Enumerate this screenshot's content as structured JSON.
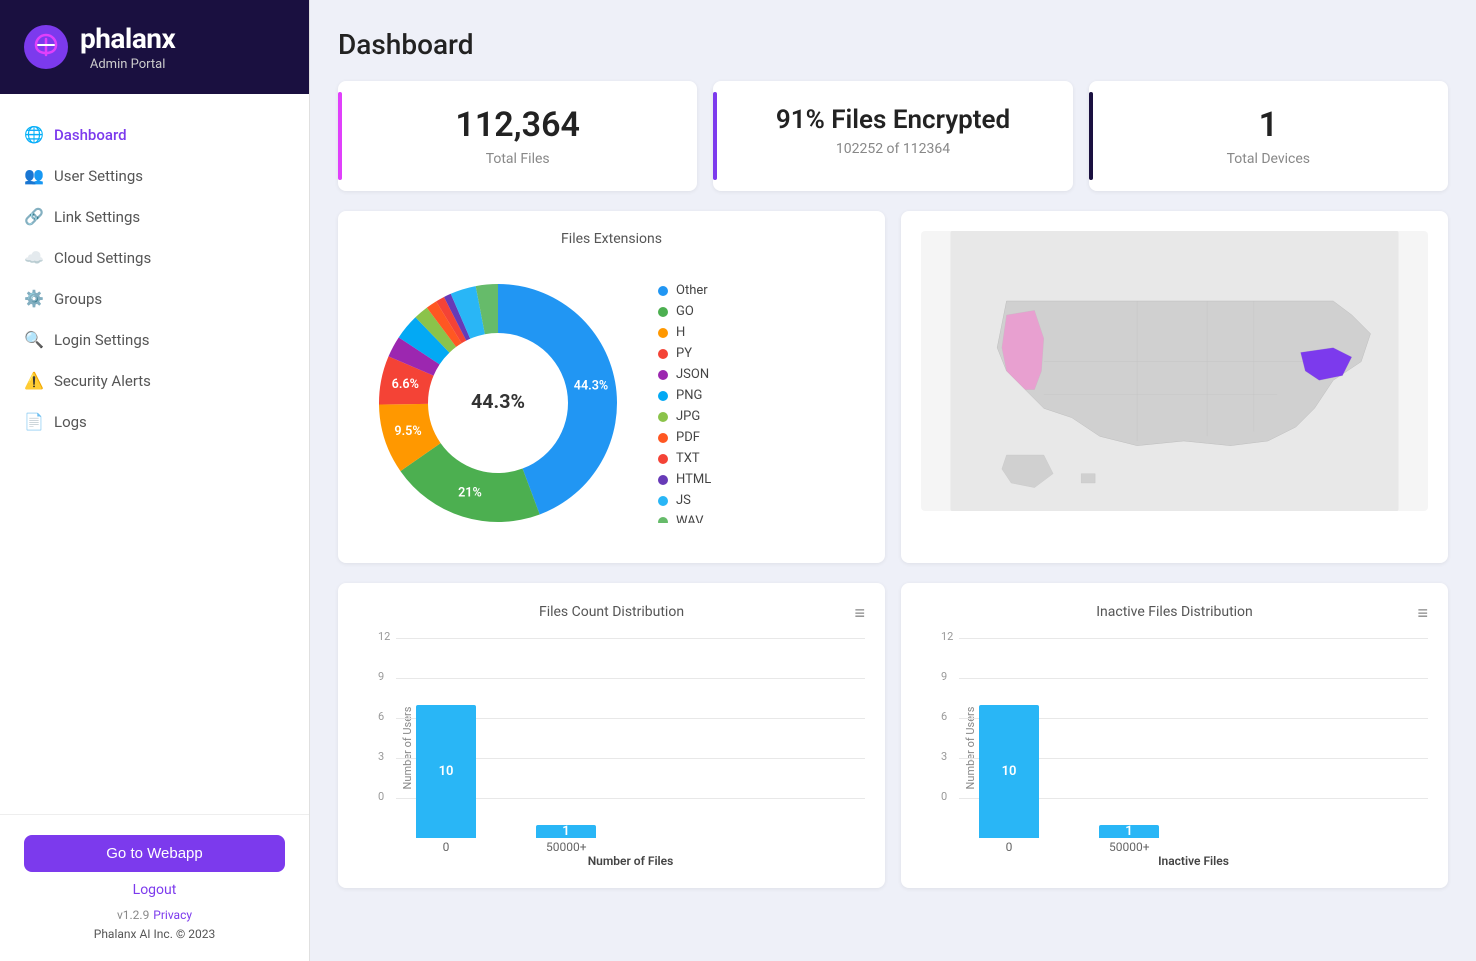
{
  "sidebar": {
    "app_name": "phalanx",
    "app_sub": "Admin Portal",
    "nav_items": [
      {
        "id": "dashboard",
        "label": "Dashboard",
        "icon": "🌐",
        "active": true
      },
      {
        "id": "user-settings",
        "label": "User Settings",
        "icon": "👥",
        "active": false
      },
      {
        "id": "link-settings",
        "label": "Link Settings",
        "icon": "🔗",
        "active": false
      },
      {
        "id": "cloud-settings",
        "label": "Cloud Settings",
        "icon": "☁️",
        "active": false
      },
      {
        "id": "groups",
        "label": "Groups",
        "icon": "⚙️",
        "active": false
      },
      {
        "id": "login-settings",
        "label": "Login Settings",
        "icon": "🔍",
        "active": false
      },
      {
        "id": "security-alerts",
        "label": "Security Alerts",
        "icon": "⚠️",
        "active": false
      },
      {
        "id": "logs",
        "label": "Logs",
        "icon": "📄",
        "active": false
      }
    ],
    "go_webapp_label": "Go to Webapp",
    "logout_label": "Logout",
    "version": "v1.2.9",
    "privacy_label": "Privacy",
    "company": "Phalanx AI Inc. © 2023"
  },
  "main": {
    "page_title": "Dashboard",
    "stat_cards": [
      {
        "id": "total-files",
        "value": "112,364",
        "label": "Total Files",
        "sub": "",
        "color": "pink"
      },
      {
        "id": "files-encrypted",
        "value": "91% Files Encrypted",
        "label": "102252 of 112364",
        "sub": "",
        "color": "purple"
      },
      {
        "id": "total-devices",
        "value": "1",
        "label": "Total Devices",
        "sub": "",
        "color": "dark"
      }
    ],
    "files_extensions": {
      "title": "Files Extensions",
      "segments": [
        {
          "label": "Other",
          "color": "#2196f3",
          "percent": 44.3
        },
        {
          "label": "GO",
          "color": "#4caf50",
          "percent": 21.0
        },
        {
          "label": "H",
          "color": "#ff9800",
          "percent": 9.5
        },
        {
          "label": "PY",
          "color": "#f44336",
          "percent": 6.6
        },
        {
          "label": "JSON",
          "color": "#9c27b0",
          "percent": 2.9
        },
        {
          "label": "PNG",
          "color": "#03a9f4",
          "percent": 3.5
        },
        {
          "label": "JPG",
          "color": "#8bc34a",
          "percent": 2.0
        },
        {
          "label": "PDF",
          "color": "#ff5722",
          "percent": 1.5
        },
        {
          "label": "TXT",
          "color": "#f44336",
          "percent": 1.2
        },
        {
          "label": "HTML",
          "color": "#673ab7",
          "percent": 1.0
        },
        {
          "label": "JS",
          "color": "#29b6f6",
          "percent": 3.5
        },
        {
          "label": "WAV",
          "color": "#66bb6a",
          "percent": 3.0
        }
      ]
    },
    "files_count_distribution": {
      "title": "Files Count Distribution",
      "y_title": "Number of Users",
      "x_title": "Number of Files",
      "y_max": 12,
      "y_labels": [
        "12",
        "9",
        "6",
        "3",
        "0"
      ],
      "bars": [
        {
          "x_label": "0",
          "value": 10
        },
        {
          "x_label": "50000+",
          "value": 1
        }
      ]
    },
    "inactive_files_distribution": {
      "title": "Inactive Files Distribution",
      "y_title": "Number of Users",
      "x_title": "Inactive Files",
      "y_max": 12,
      "y_labels": [
        "12",
        "9",
        "6",
        "3",
        "0"
      ],
      "bars": [
        {
          "x_label": "0",
          "value": 10
        },
        {
          "x_label": "50000+",
          "value": 1
        }
      ]
    }
  }
}
